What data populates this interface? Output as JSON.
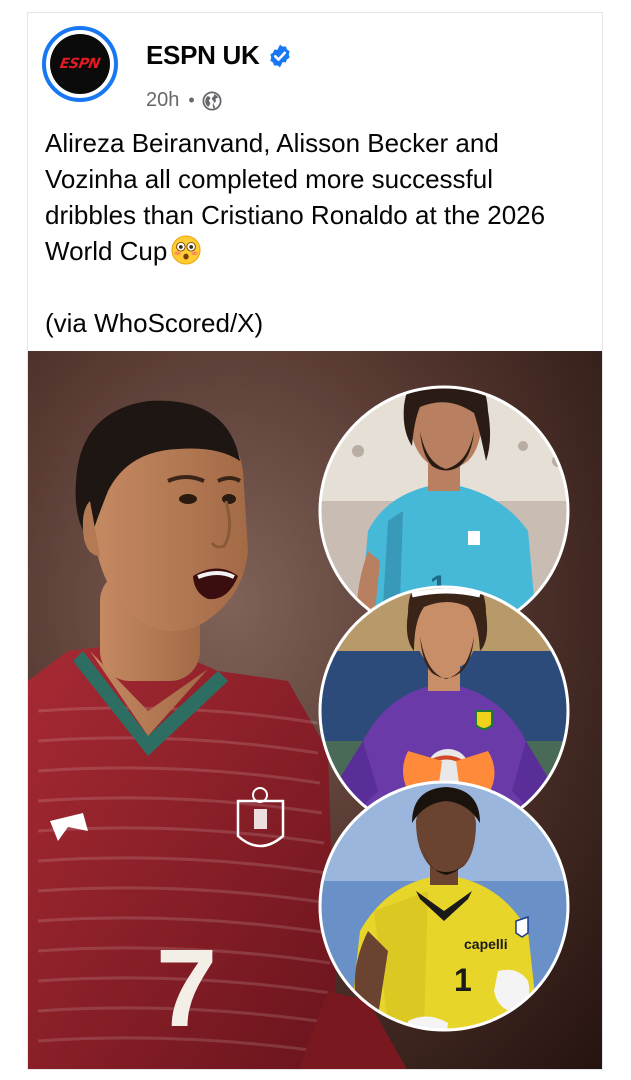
{
  "post": {
    "page_name": "ESPN UK",
    "avatar_logo_text": "ESPN",
    "verified_icon": "verified-badge-icon",
    "time": "20h",
    "separator": "•",
    "audience_icon": "globe-icon",
    "text_line_1": "Alireza Beiranvand, Alisson Becker and Vozinha all completed more successful dribbles than Cristiano Ronaldo at the 2026 World Cup",
    "emoji": "flushed-face-emoji",
    "text_line_2": "(via WhoScored/X)"
  },
  "photo": {
    "main_player_shirt_number": "7",
    "inset_1_shirt_number": "1",
    "inset_3_shirt_number": "1",
    "inset_3_sponsor": "capelli",
    "colors": {
      "background": "#5a3a32",
      "main_shirt": "#8e1f2a",
      "inset_1_shirt": "#46b8d8",
      "inset_2_shirt": "#6a3aa8",
      "inset_3_shirt": "#e8d52a"
    }
  },
  "colors": {
    "accent": "#1877f2",
    "text": "#050505",
    "muted": "#65676b",
    "espn_red": "#e31b23"
  }
}
